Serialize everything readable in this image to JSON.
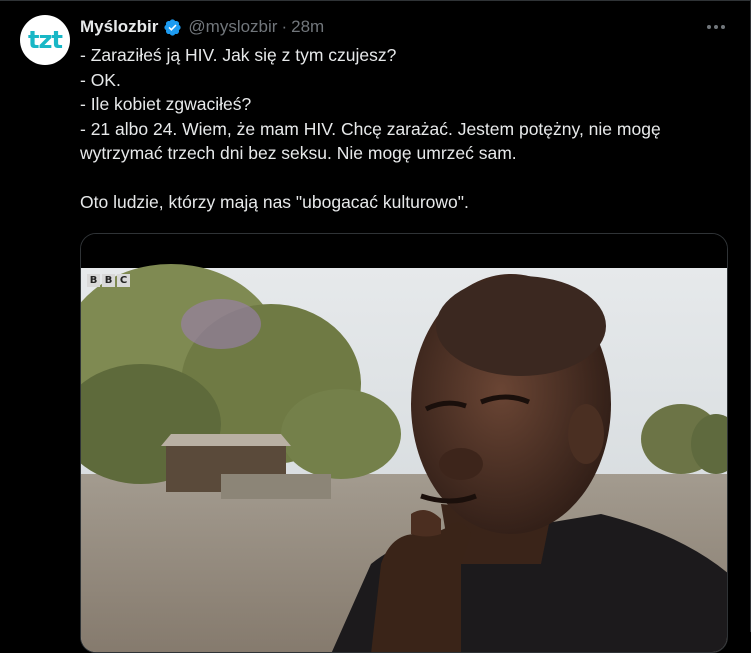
{
  "author": {
    "display_name": "Myślozbir",
    "handle": "@myslozbir",
    "separator": "·",
    "time": "28m",
    "avatar_text": "tzt",
    "verified_color": "#1d9bf0"
  },
  "tweet_lines": [
    "- Zaraziłeś ją HIV. Jak się z tym czujesz?",
    "- OK.",
    "- Ile kobiet zgwaciłeś?",
    "- 21 albo 24. Wiem, że mam HIV. Chcę zarażać. Jestem potężny, nie mogę",
    "wytrzymać trzech dni bez seksu. Nie mogę umrzeć sam.",
    "",
    "Oto ludzie, którzy mają nas \"ubogacać kulturowo\"."
  ],
  "media": {
    "watermark": [
      "B",
      "B",
      "C"
    ]
  },
  "colors": {
    "background": "#000000",
    "text": "#e7e9ea",
    "muted": "#71767b",
    "border": "#2f3336",
    "accent": "#1d9bf0"
  }
}
